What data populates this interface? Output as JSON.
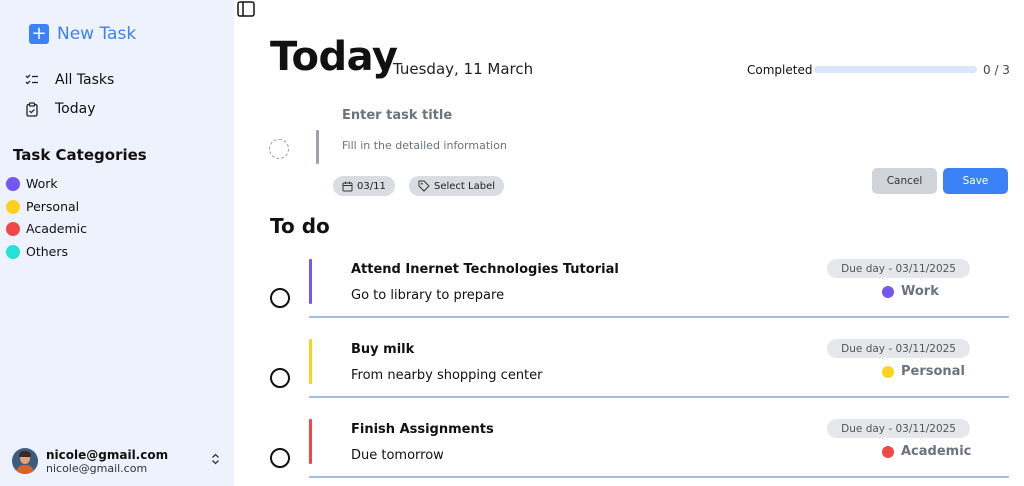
{
  "sidebar": {
    "new_task": "New Task",
    "nav": [
      {
        "label": "All Tasks",
        "icon": "checklist-icon"
      },
      {
        "label": "Today",
        "icon": "clipboard-icon"
      }
    ],
    "categories_title": "Task Categories",
    "categories": [
      {
        "label": "Work",
        "color": "#7456f1"
      },
      {
        "label": "Personal",
        "color": "#fdd21f"
      },
      {
        "label": "Academic",
        "color": "#f04848"
      },
      {
        "label": "Others",
        "color": "#22e3d6"
      }
    ],
    "user": {
      "name": "nicole@gmail.com",
      "email": "nicole@gmail.com"
    }
  },
  "header": {
    "title": "Today",
    "date": "Tuesday, 11 March",
    "completed_label": "Completed",
    "progress": 0,
    "count": "0 / 3"
  },
  "new_task": {
    "title_placeholder": "Enter task title",
    "desc_placeholder": "Fill in the detailed information",
    "date_chip": "03/11",
    "label_chip": "Select Label",
    "cancel": "Cancel",
    "save": "Save"
  },
  "todo": {
    "title": "To do",
    "tasks": [
      {
        "name": "Attend Inernet Technologies Tutorial",
        "desc": "Go to library to prepare",
        "due": "Due day - 03/11/2025",
        "category": "Work",
        "color": "#7456f1"
      },
      {
        "name": "Buy milk",
        "desc": "From nearby shopping center",
        "due": "Due day - 03/11/2025",
        "category": "Personal",
        "color": "#fdd21f"
      },
      {
        "name": "Finish Assignments",
        "desc": "Due tomorrow",
        "due": "Due day - 03/11/2025",
        "category": "Academic",
        "color": "#f04848"
      }
    ]
  },
  "colors": {
    "accent": "#3b82f6",
    "sidebar_bg": "#eef2fd"
  }
}
